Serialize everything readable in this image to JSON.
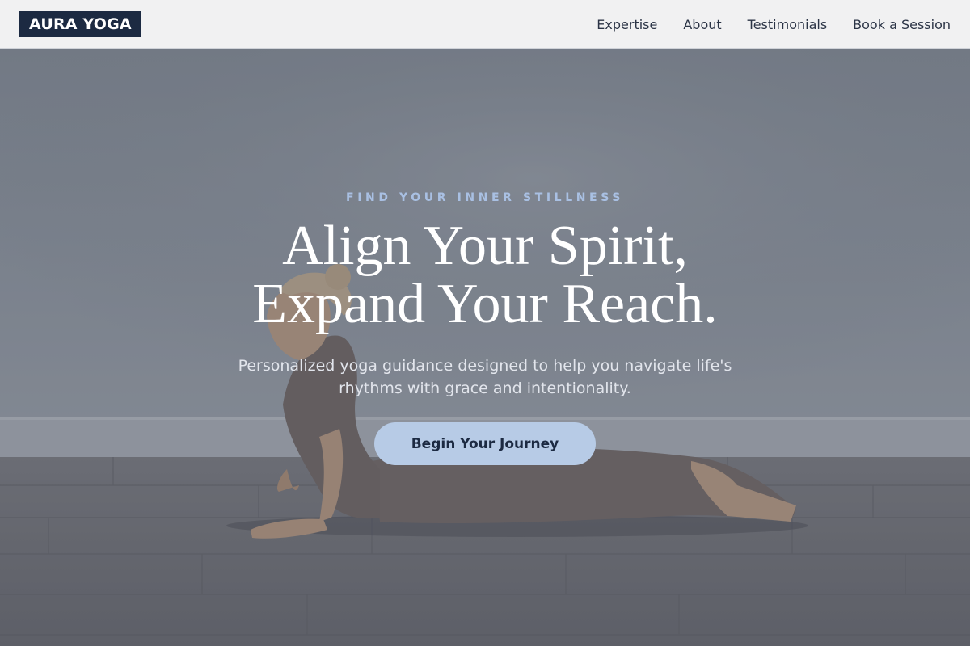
{
  "brand": {
    "logo_text": "AURA YOGA"
  },
  "nav": {
    "items": [
      {
        "label": "Expertise"
      },
      {
        "label": "About"
      },
      {
        "label": "Testimonials"
      },
      {
        "label": "Book a Session"
      }
    ]
  },
  "hero": {
    "eyebrow": "FIND YOUR INNER STILLNESS",
    "headline_line1": "Align Your Spirit,",
    "headline_line2": "Expand Your Reach.",
    "subtitle": "Personalized yoga guidance designed to help you navigate life's rhythms with grace and intentionality.",
    "cta_label": "Begin Your Journey",
    "background_image": "woman-in-cobra-pose-photo"
  },
  "colors": {
    "brand_navy": "#1c2a42",
    "accent_blue": "#b7cbe6",
    "eyebrow_blue": "#a9c0e3",
    "header_bg": "#f1f1f2"
  }
}
